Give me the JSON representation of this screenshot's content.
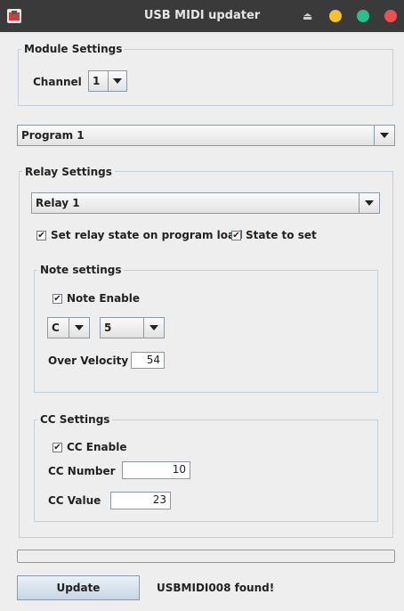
{
  "window": {
    "title": "USB MIDI updater"
  },
  "module_settings": {
    "title": "Module Settings",
    "channel_label": "Channel",
    "channel_value": "1"
  },
  "program": {
    "selected": "Program 1"
  },
  "relay_settings": {
    "title": "Relay Settings",
    "relay_selected": "Relay 1",
    "set_state_label": "Set relay state on program load",
    "set_state_checked": true,
    "state_to_set_label": "State to set",
    "state_to_set_checked": true
  },
  "note_settings": {
    "title": "Note settings",
    "enable_label": "Note Enable",
    "enable_checked": true,
    "note_value": "C",
    "octave_value": "5",
    "over_velocity_label": "Over Velocity",
    "over_velocity_value": "54"
  },
  "cc_settings": {
    "title": "CC Settings",
    "enable_label": "CC Enable",
    "enable_checked": true,
    "cc_number_label": "CC Number",
    "cc_number_value": "10",
    "cc_value_label": "CC Value",
    "cc_value_value": "23"
  },
  "footer": {
    "progress": 0,
    "update_button": "Update",
    "status": "USBMIDI008 found!"
  },
  "icons": {
    "check": "✔",
    "window_colors": {
      "minimize": "#f5c12e",
      "maximize": "#27c08c",
      "close": "#ee5050"
    }
  }
}
